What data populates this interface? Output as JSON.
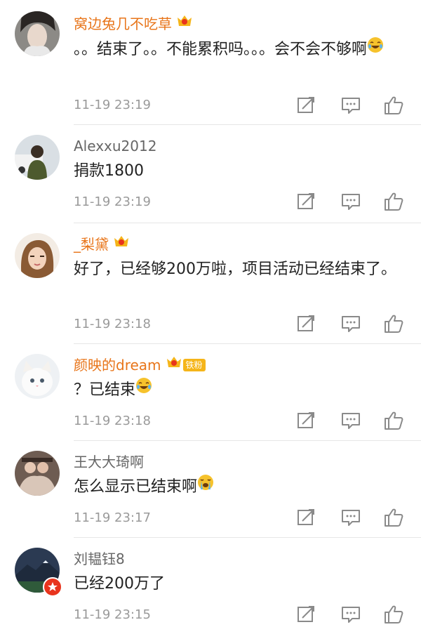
{
  "comments": [
    {
      "user": "窝边兔几不吃草",
      "text": "。。结束了。。不能累积吗。。。会不会不够啊",
      "time": "11-19 23:19"
    },
    {
      "user": "Alexxu2012",
      "text": "捐款1800",
      "time": "11-19 23:19"
    },
    {
      "user": "_梨黛",
      "text": "好了，已经够200万啦，项目活动已经结束了。",
      "time": "11-19 23:18"
    },
    {
      "user": "颜映的dream",
      "fan_badge": "铁粉",
      "text": "？已结束",
      "time": "11-19 23:18"
    },
    {
      "user": "王大大琦啊",
      "text": "怎么显示已结束啊",
      "time": "11-19 23:17"
    },
    {
      "user": "刘韫钰8",
      "text": "已经200万了",
      "time": "11-19 23:15"
    }
  ],
  "colors": {
    "vip_name": "#e8751a",
    "normal_name": "#666666",
    "meta": "#9a9a9a"
  },
  "icons": [
    "share-icon",
    "comment-icon",
    "like-icon",
    "vip-crown-icon",
    "laugh-cry-emoji",
    "crying-emoji"
  ]
}
